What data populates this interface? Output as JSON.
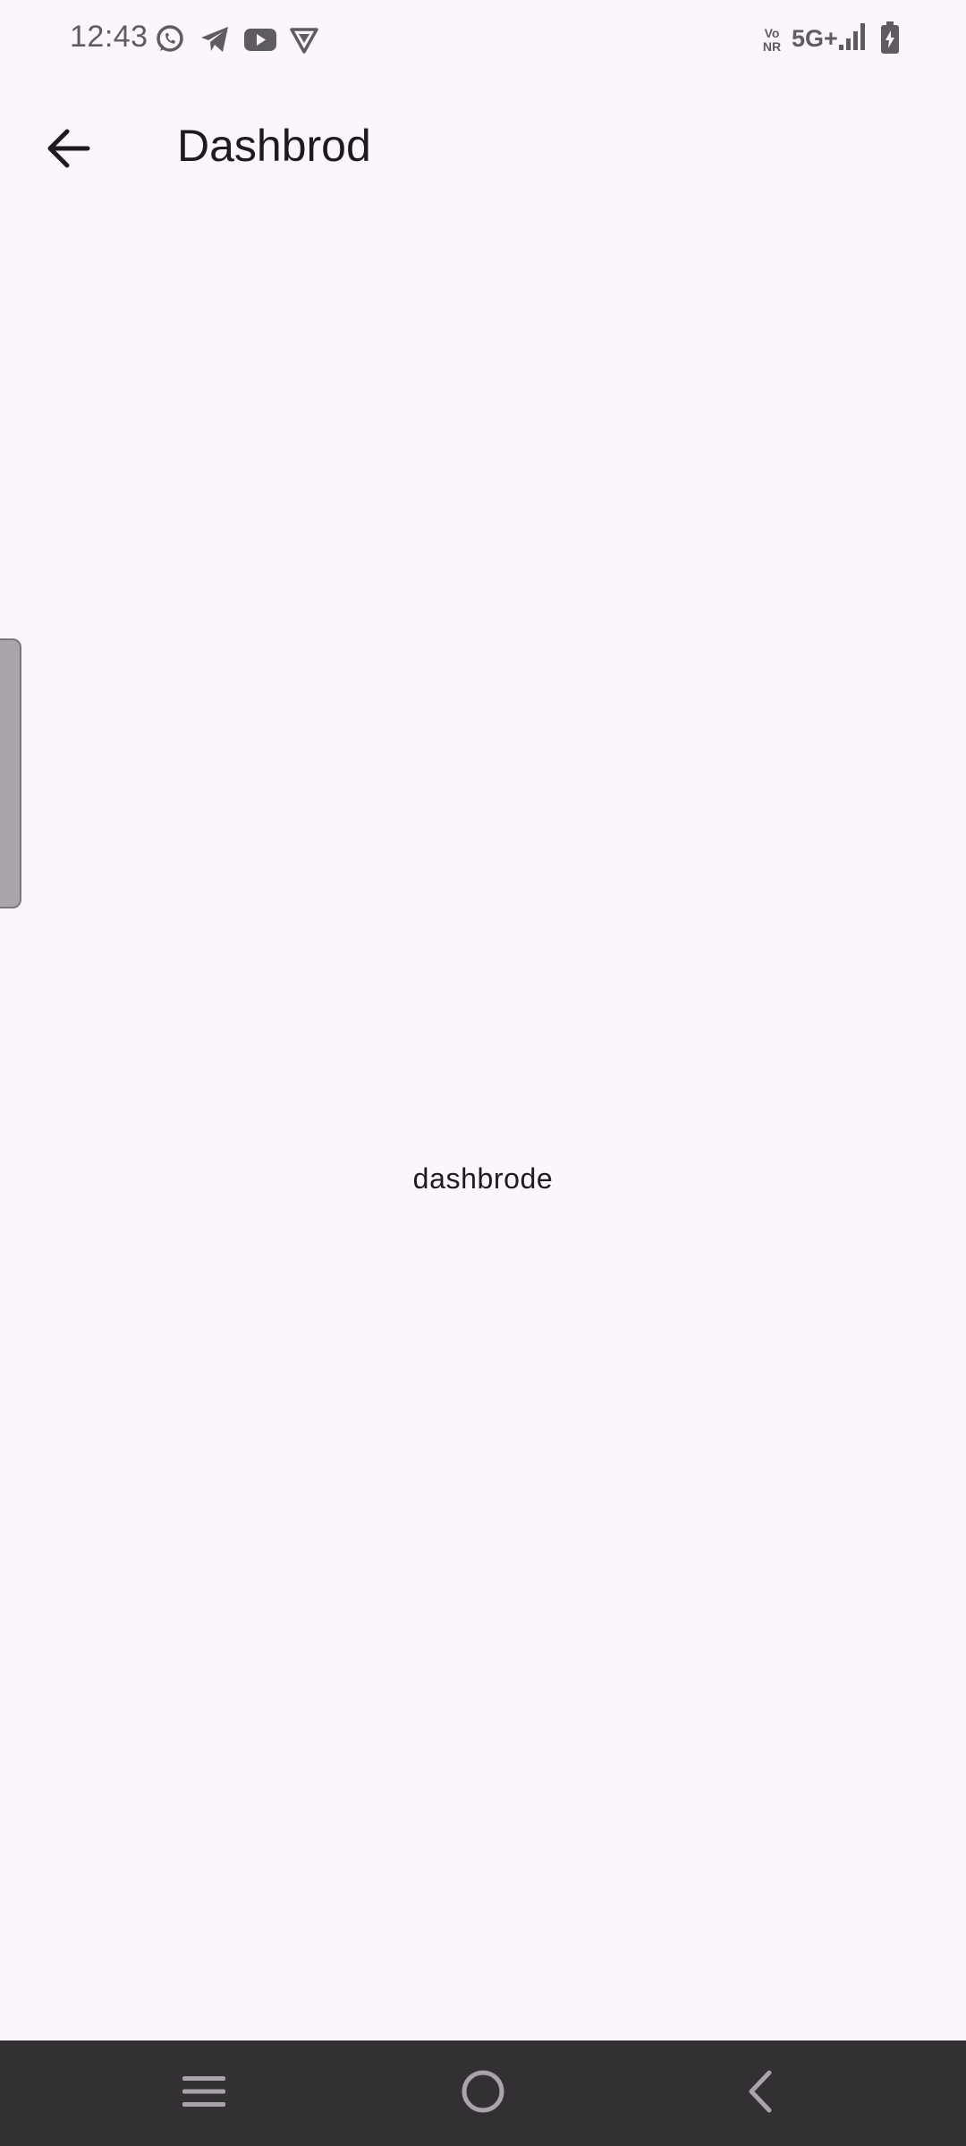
{
  "status_bar": {
    "time": "12:43",
    "network": "5G+",
    "volte": "Vo NR",
    "icons_left": [
      "whatsapp-icon",
      "telegram-icon",
      "youtube-icon",
      "vpn-shield-icon"
    ],
    "icons_right": [
      "signal-icon",
      "battery-charging-icon"
    ]
  },
  "app_bar": {
    "title": "Dashbrod",
    "back_icon": "arrow-back-icon"
  },
  "main": {
    "text": "dashbrode"
  },
  "nav_bar": {
    "buttons": [
      "recents-menu-icon",
      "home-circle-icon",
      "back-chevron-icon"
    ]
  },
  "colors": {
    "background": "#fcf6fc",
    "text": "#1d1b20",
    "nav_background": "#333034",
    "nav_icon": "#a8a4a9",
    "handle": "#a9a5aa"
  }
}
